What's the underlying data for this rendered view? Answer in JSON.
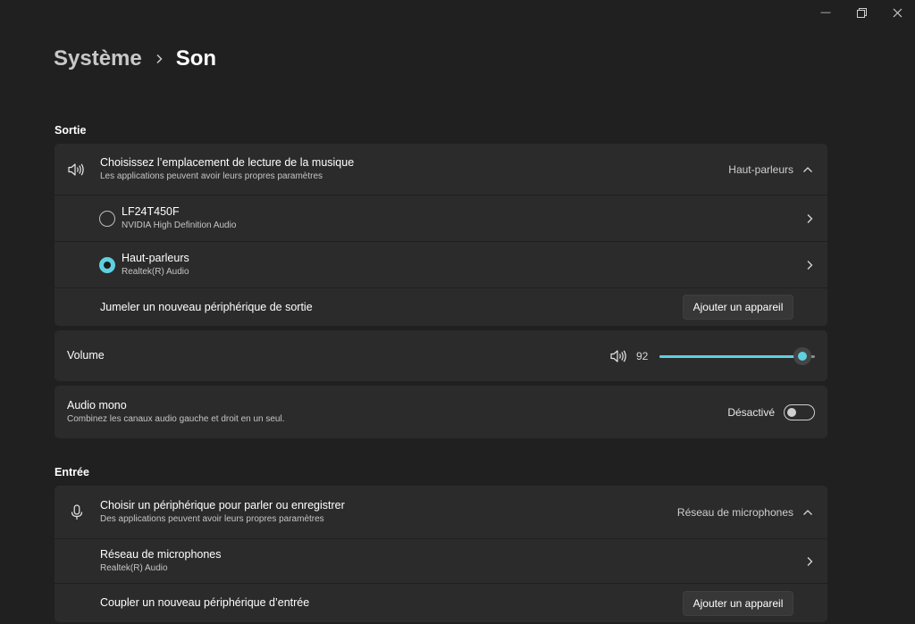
{
  "window": {
    "minimize_glyph": "—",
    "restore_icon": "restore-icon",
    "close_icon": "close-icon"
  },
  "breadcrumb": {
    "parent": "Système",
    "current": "Son"
  },
  "output": {
    "section_title": "Sortie",
    "chooser": {
      "title": "Choisissez l’emplacement de lecture de la musique",
      "subtitle": "Les applications peuvent avoir leurs propres paramètres",
      "value": "Haut-parleurs",
      "icon": "speaker-icon",
      "expanded": true
    },
    "devices": [
      {
        "name": "LF24T450F",
        "driver": "NVIDIA High Definition Audio",
        "selected": false
      },
      {
        "name": "Haut-parleurs",
        "driver": "Realtek(R) Audio",
        "selected": true
      }
    ],
    "pair": {
      "label": "Jumeler un nouveau périphérique de sortie",
      "button": "Ajouter un appareil"
    },
    "volume": {
      "label": "Volume",
      "value": "92",
      "level": 92
    },
    "mono": {
      "title": "Audio mono",
      "subtitle": "Combinez les canaux audio gauche et droit en un seul.",
      "state": "Désactivé",
      "on": false
    }
  },
  "input": {
    "section_title": "Entrée",
    "chooser": {
      "title": "Choisir un périphérique pour parler ou enregistrer",
      "subtitle": "Des applications peuvent avoir leurs propres paramètres",
      "value": "Réseau de microphones",
      "icon": "microphone-icon",
      "expanded": true
    },
    "devices": [
      {
        "name": "Réseau de microphones",
        "driver": "Realtek(R) Audio"
      }
    ],
    "pair": {
      "label": "Coupler un nouveau périphérique d’entrée",
      "button": "Ajouter un appareil"
    }
  },
  "colors": {
    "accent": "#5fd0e0",
    "background": "#202020",
    "card": "#2b2b2b"
  }
}
